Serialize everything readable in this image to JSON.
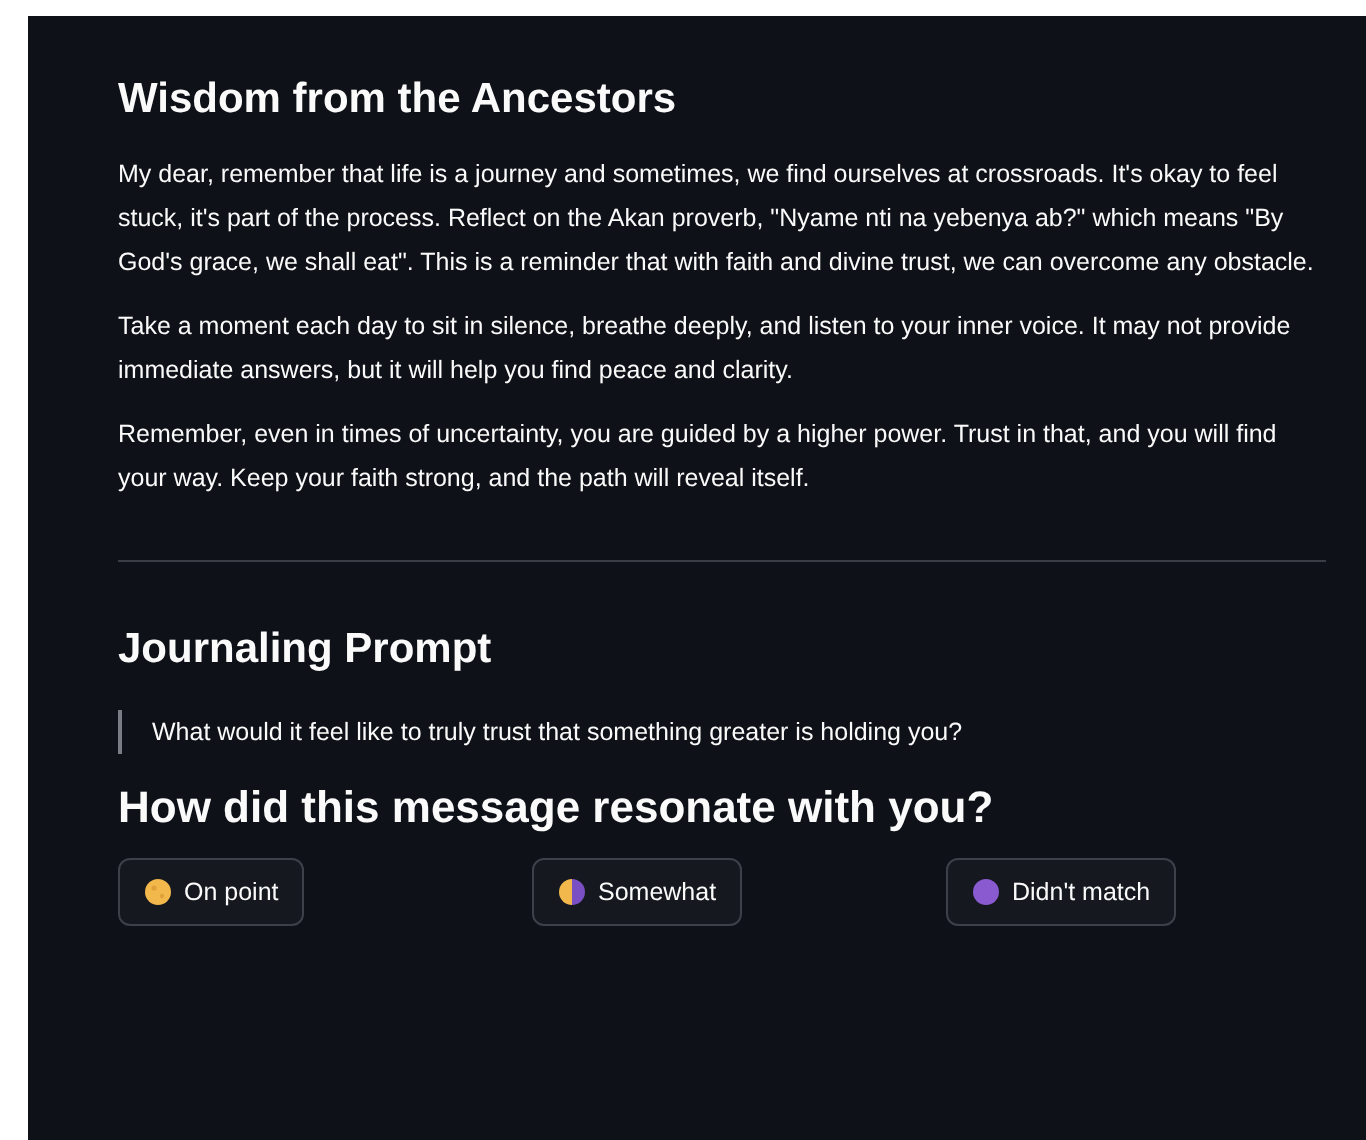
{
  "wisdom": {
    "title": "Wisdom from the Ancestors",
    "paragraphs": [
      "My dear, remember that life is a journey and sometimes, we find ourselves at crossroads. It's okay to feel stuck, it's part of the process. Reflect on the Akan proverb, \"Nyame nti na yebenya ab?\" which means \"By God's grace, we shall eat\". This is a reminder that with faith and divine trust, we can overcome any obstacle.",
      "Take a moment each day to sit in silence, breathe deeply, and listen to your inner voice. It may not provide immediate answers, but it will help you find peace and clarity.",
      "Remember, even in times of uncertainty, you are guided by a higher power. Trust in that, and you will find your way. Keep your faith strong, and the path will reveal itself."
    ]
  },
  "journaling": {
    "title": "Journaling Prompt",
    "quote": "What would it feel like to truly trust that something greater is holding you?"
  },
  "feedback": {
    "title": "How did this message resonate with you?",
    "buttons": [
      {
        "label": "On point",
        "kind": "full"
      },
      {
        "label": "Somewhat",
        "kind": "half"
      },
      {
        "label": "Didn't match",
        "kind": "purple"
      }
    ]
  }
}
